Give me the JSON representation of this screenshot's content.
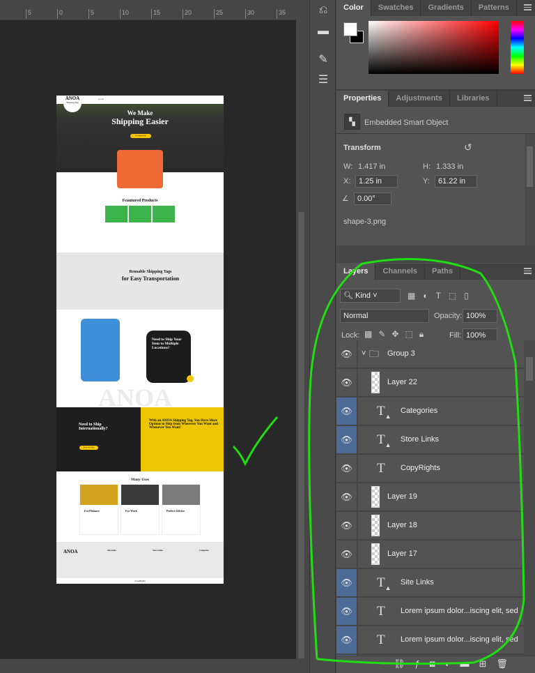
{
  "ruler": {
    "ticks": [
      "5",
      "0",
      "5",
      "10",
      "15",
      "20",
      "25",
      "30",
      "35"
    ]
  },
  "toolbar": {
    "icons": [
      "history-icon",
      "comments-icon",
      "brush-presets-icon",
      "adjust-sliders-icon"
    ]
  },
  "color_panel": {
    "tabs": [
      "Color",
      "Swatches",
      "Gradients",
      "Patterns"
    ],
    "foreground": "#ffffff",
    "background": "#000000",
    "hue": "#ff0000"
  },
  "properties_panel": {
    "tabs": [
      "Properties",
      "Adjustments",
      "Libraries"
    ],
    "object_type": "Embedded Smart Object",
    "section": "Transform",
    "w_label": "W:",
    "w": "1.417 in",
    "h_label": "H:",
    "h": "1.333 in",
    "x_label": "X:",
    "x": "1.25 in",
    "y_label": "Y:",
    "y": "61.22 in",
    "angle": "0.00°",
    "filename": "shape-3.png"
  },
  "layers_panel": {
    "tabs": [
      "Layers",
      "Channels",
      "Paths"
    ],
    "filter": "Kind",
    "blend_mode": "Normal",
    "opacity_label": "Opacity:",
    "opacity": "100%",
    "lock_label": "Lock:",
    "fill_label": "Fill:",
    "fill": "100%",
    "layers": [
      {
        "name": "Group 3",
        "kind": "group",
        "selected": false
      },
      {
        "name": "Layer 22",
        "kind": "pixel",
        "selected": false
      },
      {
        "name": "Categories",
        "kind": "text-warning",
        "selected": true
      },
      {
        "name": "Store Links",
        "kind": "text-warning",
        "selected": true
      },
      {
        "name": "CopyRights",
        "kind": "text",
        "selected": false
      },
      {
        "name": "Layer 19",
        "kind": "pixel",
        "selected": false
      },
      {
        "name": "Layer 18",
        "kind": "pixel",
        "selected": false
      },
      {
        "name": "Layer 17",
        "kind": "pixel",
        "selected": false
      },
      {
        "name": "Site Links",
        "kind": "text-warning",
        "selected": true
      },
      {
        "name": "Lorem ipsum dolor...iscing elit, sed",
        "kind": "text",
        "selected": true
      },
      {
        "name": "Lorem ipsum dolor...iscing elit, sed",
        "kind": "text",
        "selected": true
      }
    ]
  },
  "annotation_color": "#22dd11",
  "document": {
    "logo": "ANOA",
    "logo_sub": "Shipping Tag",
    "nav": [
      "Home",
      "Shop",
      "Pros",
      "Reusable Features",
      "Tips",
      "Videos",
      "Contact"
    ],
    "hero_line1": "We Make",
    "hero_line2": "Shipping Easier",
    "hero_button": "Get Shipping Tags",
    "featured_title": "Feautured Products",
    "reusable_title1": "Reusable Shipping Tags",
    "reusable_title2": "for Easy Transportation",
    "multi_title": "Need to Ship Your Item to Multiple Locations?",
    "watermark": "ANOA",
    "intl_title": "Need to Ship Internationally?",
    "intl_button": "Reach Out Today",
    "options_title": "With an ANOA Shipping Tag, You Have More Options to Ship from Wherever You Want and Whenever You Want!",
    "uses_title": "Many Uses",
    "uses": [
      "For Pleasure",
      "For Work",
      "Perfect Gift for"
    ],
    "footer_cols": [
      "Site Links",
      "Store Links",
      "Categories"
    ],
    "copyright": "CopyRights"
  }
}
